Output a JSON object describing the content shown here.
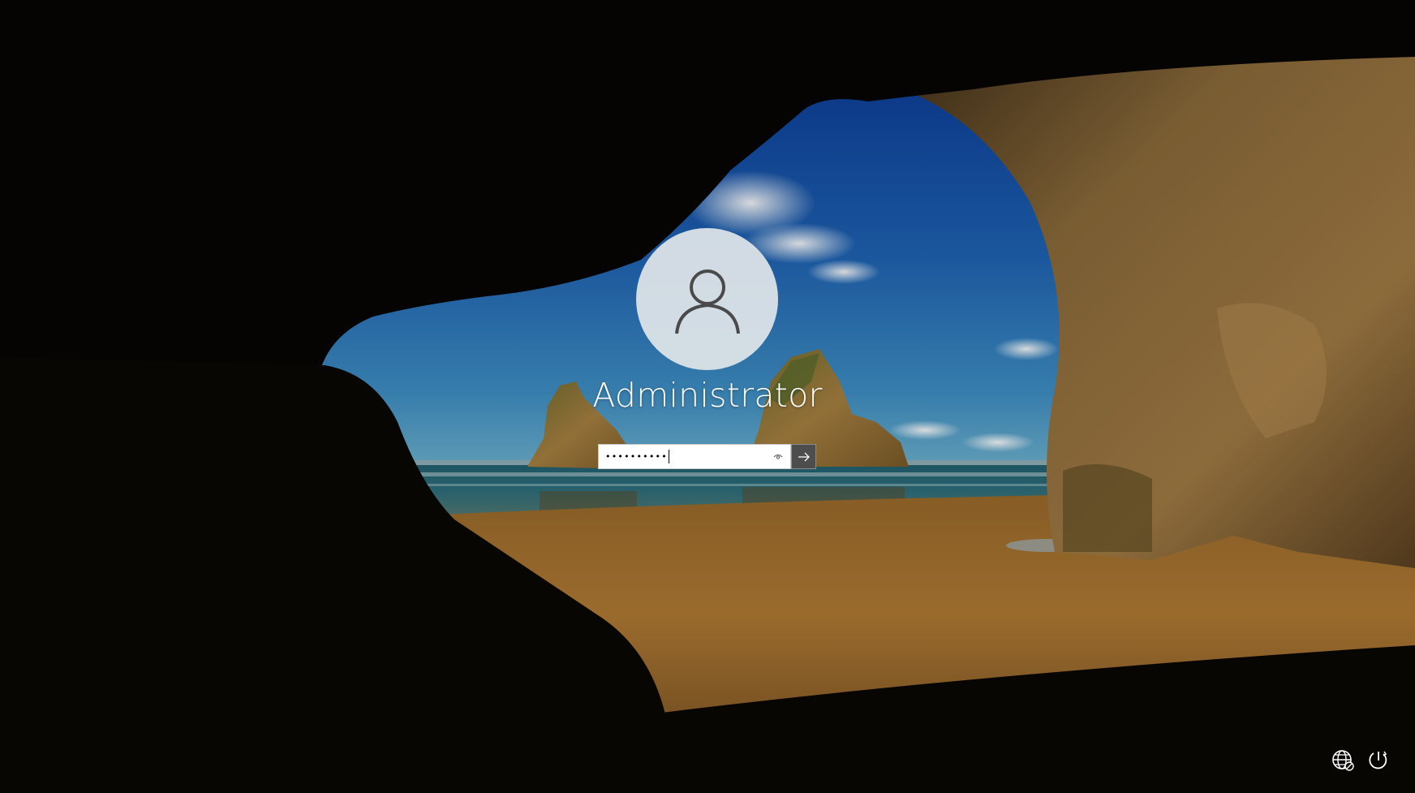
{
  "lock_screen": {
    "user": {
      "name": "Administrator",
      "avatar_icon": "user-silhouette-icon"
    },
    "password": {
      "masked_value": "••••••••••",
      "reveal_icon": "eye-icon",
      "submit_icon": "arrow-right-icon"
    },
    "corner_buttons": {
      "network_icon": "network-globe-icon",
      "power_icon": "power-icon"
    },
    "colors": {
      "avatar_bg": "#e0e5e8",
      "text": "#ffffff",
      "submit_bg": "#4d4d4d",
      "sky": "#1f63b3",
      "sand": "#b07a34"
    }
  }
}
